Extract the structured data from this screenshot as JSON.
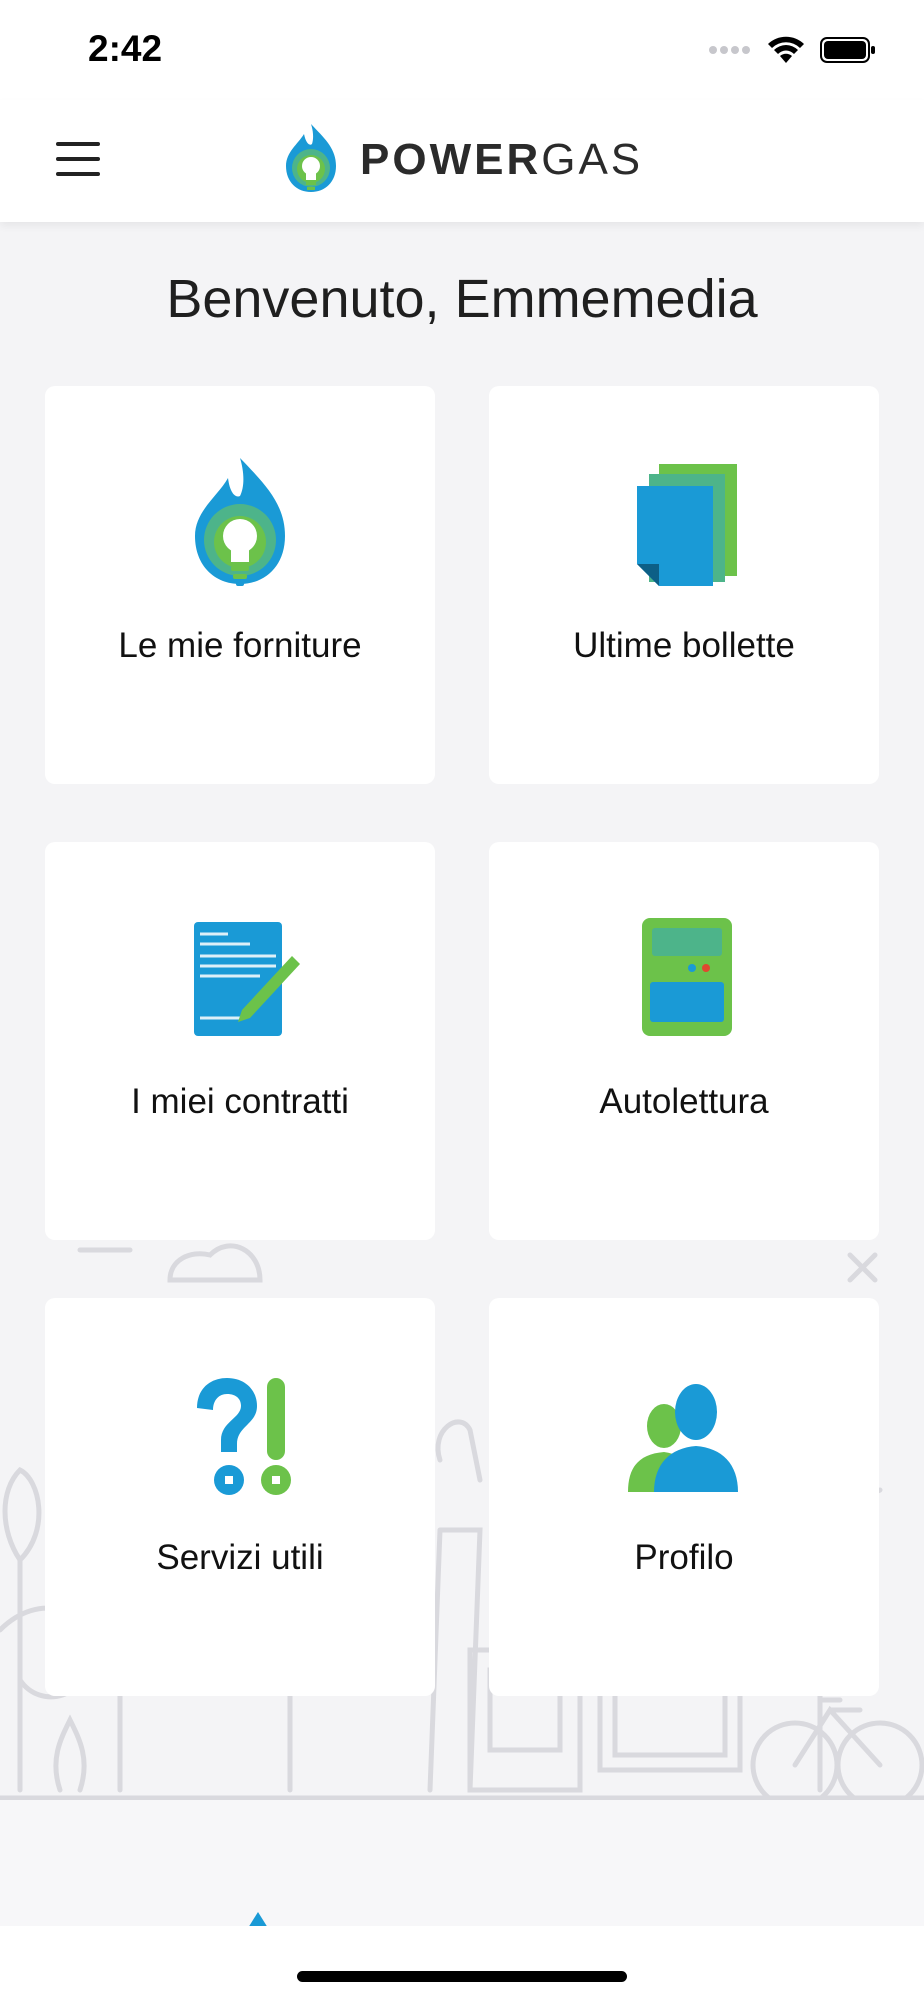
{
  "status_bar": {
    "time": "2:42",
    "icons": [
      "signal-dots-icon",
      "wifi-icon",
      "battery-icon"
    ]
  },
  "header": {
    "menu_icon": "hamburger-menu-icon",
    "logo": {
      "word_bold": "POWER",
      "word_light": "GAS"
    }
  },
  "welcome_text": "Benvenuto, Emmemedia",
  "tiles": [
    {
      "label": "Le mie forniture",
      "icon": "flame-bulb-icon"
    },
    {
      "label": "Ultime bollette",
      "icon": "documents-stack-icon"
    },
    {
      "label": "I miei contratti",
      "icon": "contract-pen-icon"
    },
    {
      "label": "Autolettura",
      "icon": "meter-device-icon"
    },
    {
      "label": "Servizi utili",
      "icon": "question-exclamation-icon"
    },
    {
      "label": "Profilo",
      "icon": "users-icon"
    }
  ],
  "colors": {
    "brand_blue": "#1a9ad6",
    "brand_green": "#6cc24a",
    "background": "#f4f4f6",
    "tile": "#ffffff"
  }
}
